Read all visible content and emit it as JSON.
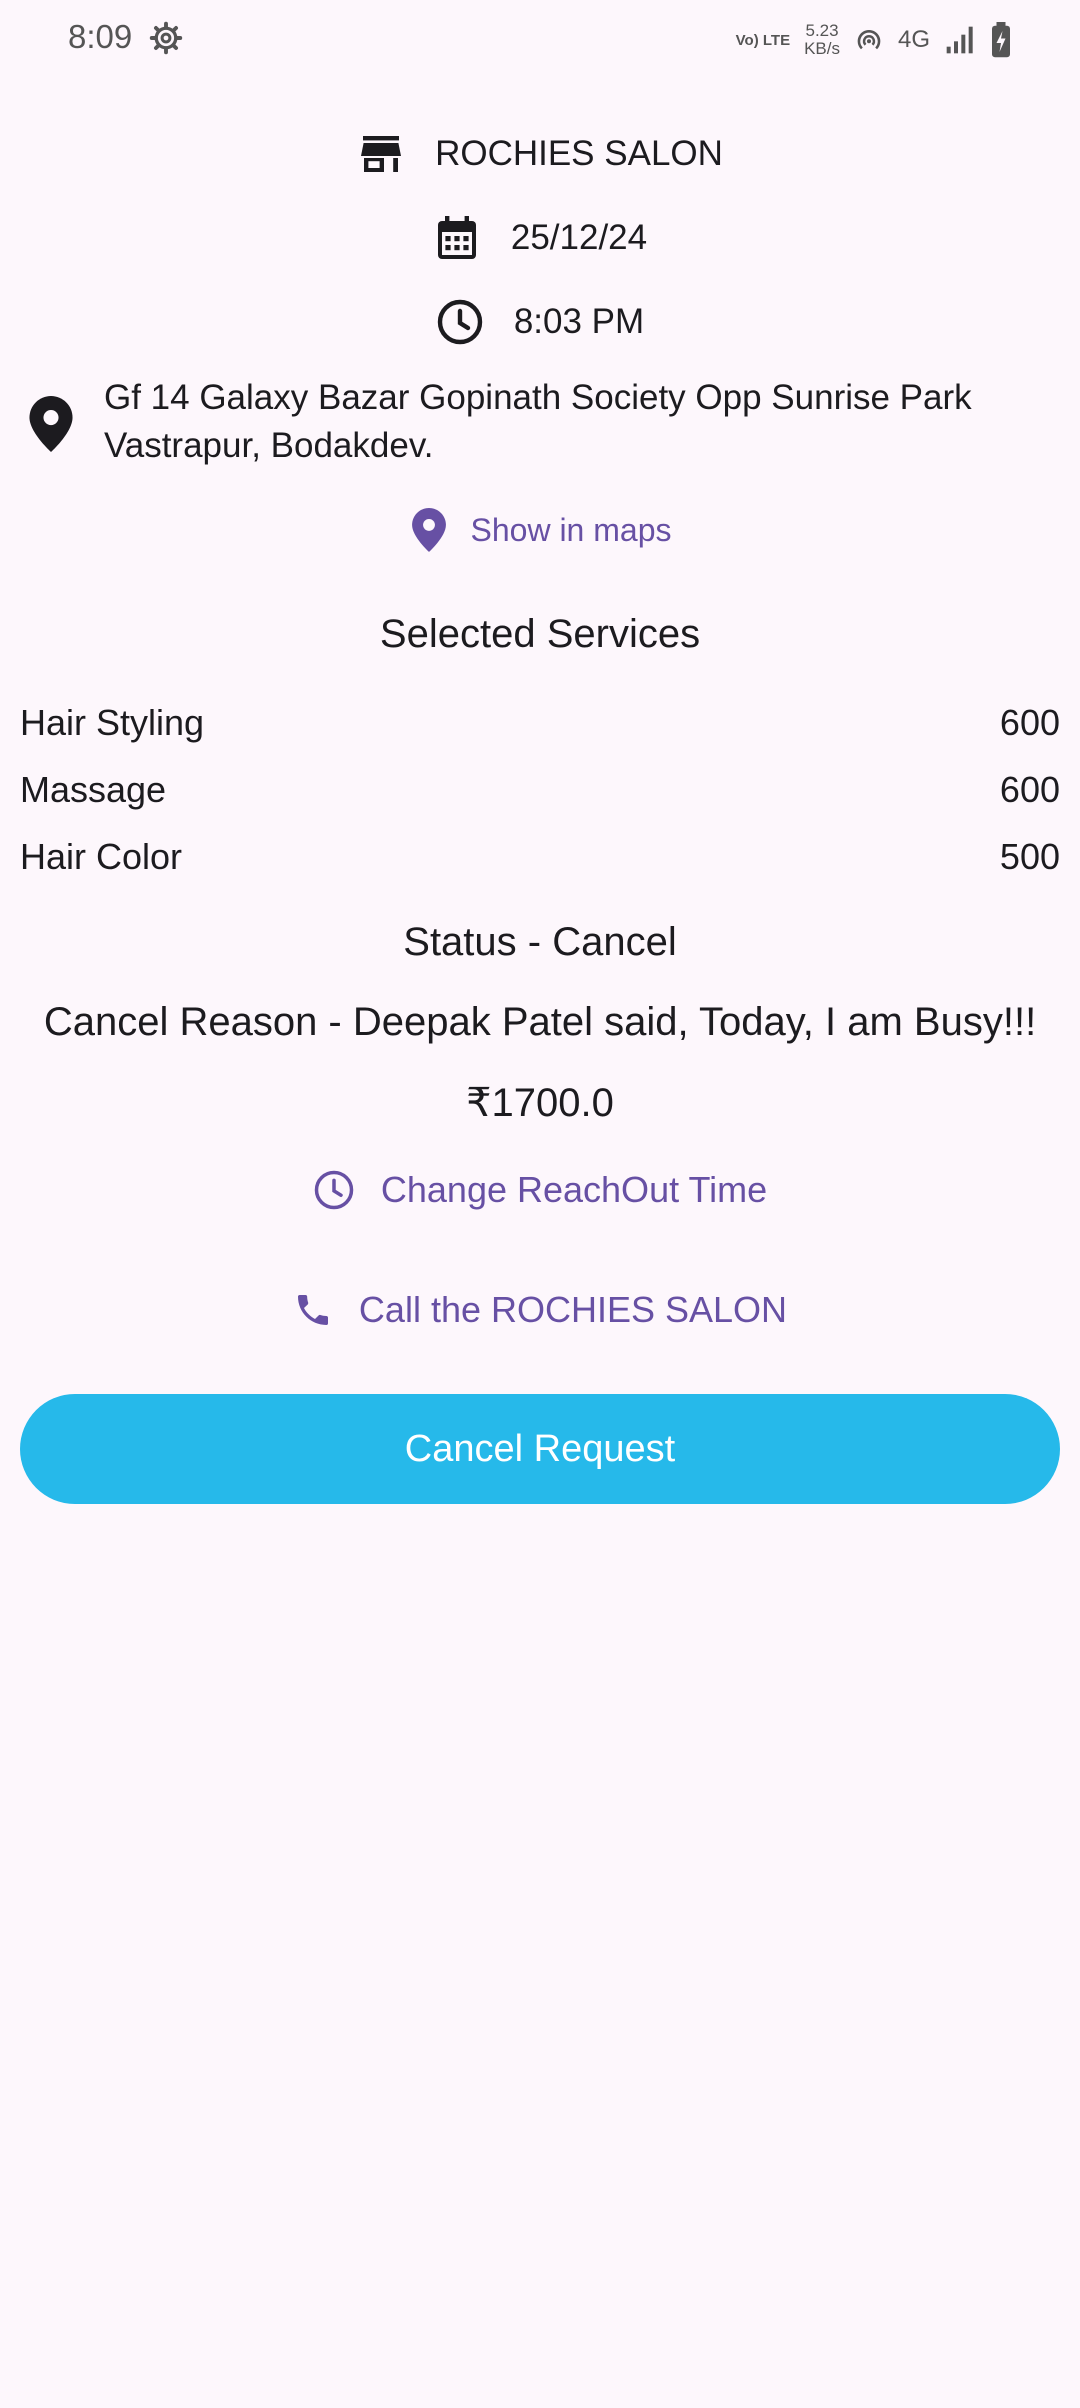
{
  "status_bar": {
    "time": "8:09",
    "volte": "Vo) LTE",
    "speed_value": "5.23",
    "speed_unit": "KB/s",
    "network": "4G"
  },
  "booking": {
    "shop_name": "ROCHIES SALON",
    "date": "25/12/24",
    "time": "8:03 PM",
    "address": "Gf 14 Galaxy Bazar Gopinath Society Opp Sunrise Park Vastrapur, Bodakdev.",
    "show_in_maps": "Show in maps"
  },
  "services": {
    "title": "Selected Services",
    "items": [
      {
        "name": "Hair Styling",
        "price": "600"
      },
      {
        "name": "Massage",
        "price": "600"
      },
      {
        "name": "Hair Color",
        "price": "500"
      }
    ]
  },
  "status_text": "Status - Cancel",
  "cancel_reason": "Cancel Reason - Deepak Patel said, Today, I am Busy!!!",
  "total": "₹1700.0",
  "actions": {
    "change_time": "Change ReachOut Time",
    "call": "Call the ROCHIES SALON",
    "cancel_request": "Cancel Request"
  },
  "colors": {
    "background": "#fdf7fc",
    "accent_purple": "#6750a4",
    "button_blue": "#26b9ea"
  },
  "icons": [
    "gear-icon",
    "store-icon",
    "calendar-icon",
    "clock-icon",
    "location-pin-icon",
    "phone-icon"
  ]
}
